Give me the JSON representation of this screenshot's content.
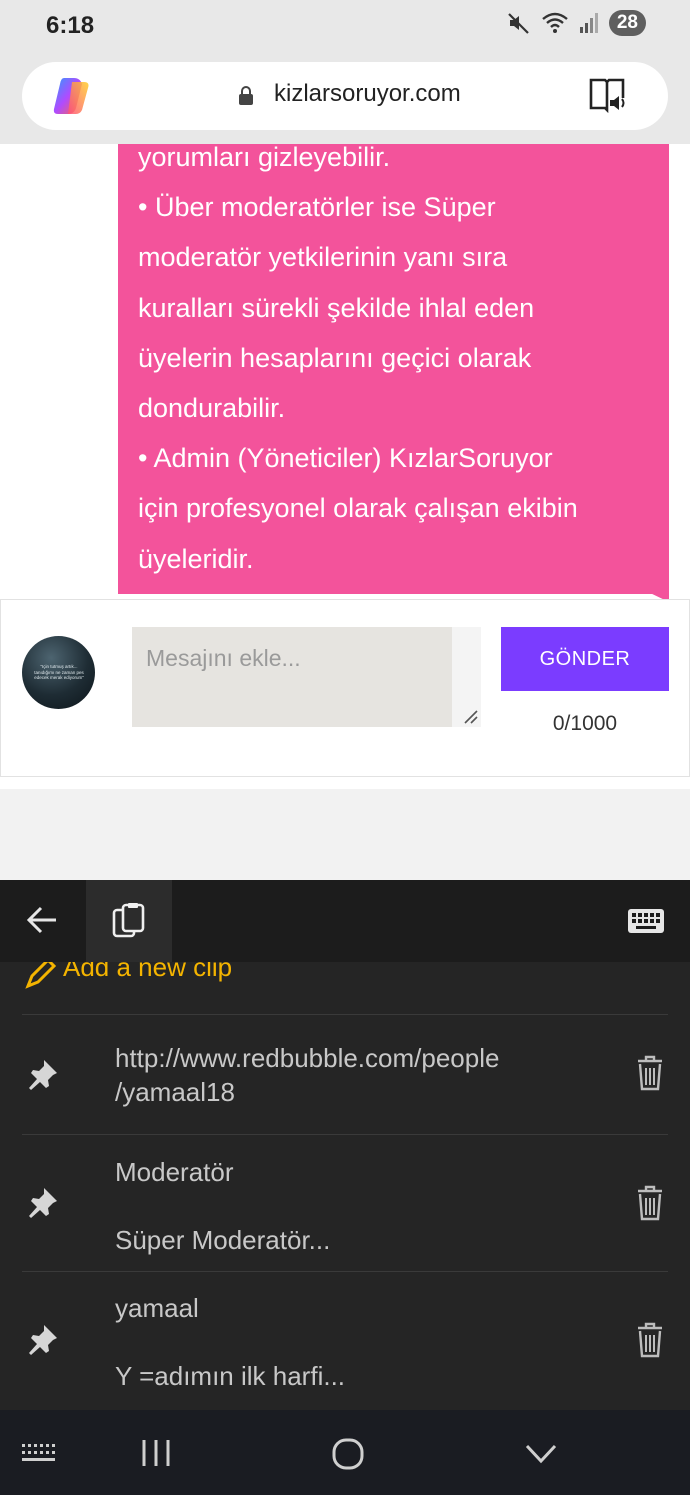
{
  "status_bar": {
    "time": "6:18",
    "battery": "28"
  },
  "browser": {
    "url": "kizlarsoruyor.com"
  },
  "bubble": {
    "lines": [
      "yorumları gizleyebilir.",
      "• Über moderatörler ise Süper",
      "moderatör yetkilerinin yanı sıra",
      "kuralları sürekli şekilde ihlal eden",
      "üyelerin hesaplarını geçici olarak",
      "dondurabilir.",
      "• Admin (Yöneticiler) KızlarSoruyor",
      "için profesyonel olarak çalışan ekibin",
      "üyeleridir."
    ]
  },
  "composer": {
    "avatar_text": "\"Için tutmuş artık... tanıdığımı ne zaman pes edecek merak ediyorum\"",
    "placeholder": "Mesajını ekle...",
    "value": "",
    "send_label": "GÖNDER",
    "char_count": "0/1000"
  },
  "clipboard": {
    "add_label": "Add a new clip",
    "items": [
      {
        "line1": "http://www.redbubble.com/people",
        "line2": "/yamaal18",
        "pinned": true
      },
      {
        "line1": "Moderatör",
        "line2": "Süper Moderatör...",
        "pinned": true
      },
      {
        "line1": "yamaal",
        "line2": "Y =adımın ilk harfi...",
        "pinned": true
      }
    ]
  },
  "colors": {
    "bubble": "#f3539b",
    "send_button": "#7b3cff",
    "accent_yellow": "#f4b400",
    "keyboard_bg": "#252525"
  },
  "icons": [
    "mute-icon",
    "wifi-icon",
    "signal-icon",
    "copilot-logo",
    "lock-icon",
    "reader-mode-icon",
    "back-arrow-icon",
    "clipboard-icon",
    "keyboard-icon",
    "pencil-icon",
    "pin-icon",
    "trash-icon",
    "keyboard-toggle-icon",
    "recents-icon",
    "home-icon",
    "chevron-down-icon"
  ]
}
